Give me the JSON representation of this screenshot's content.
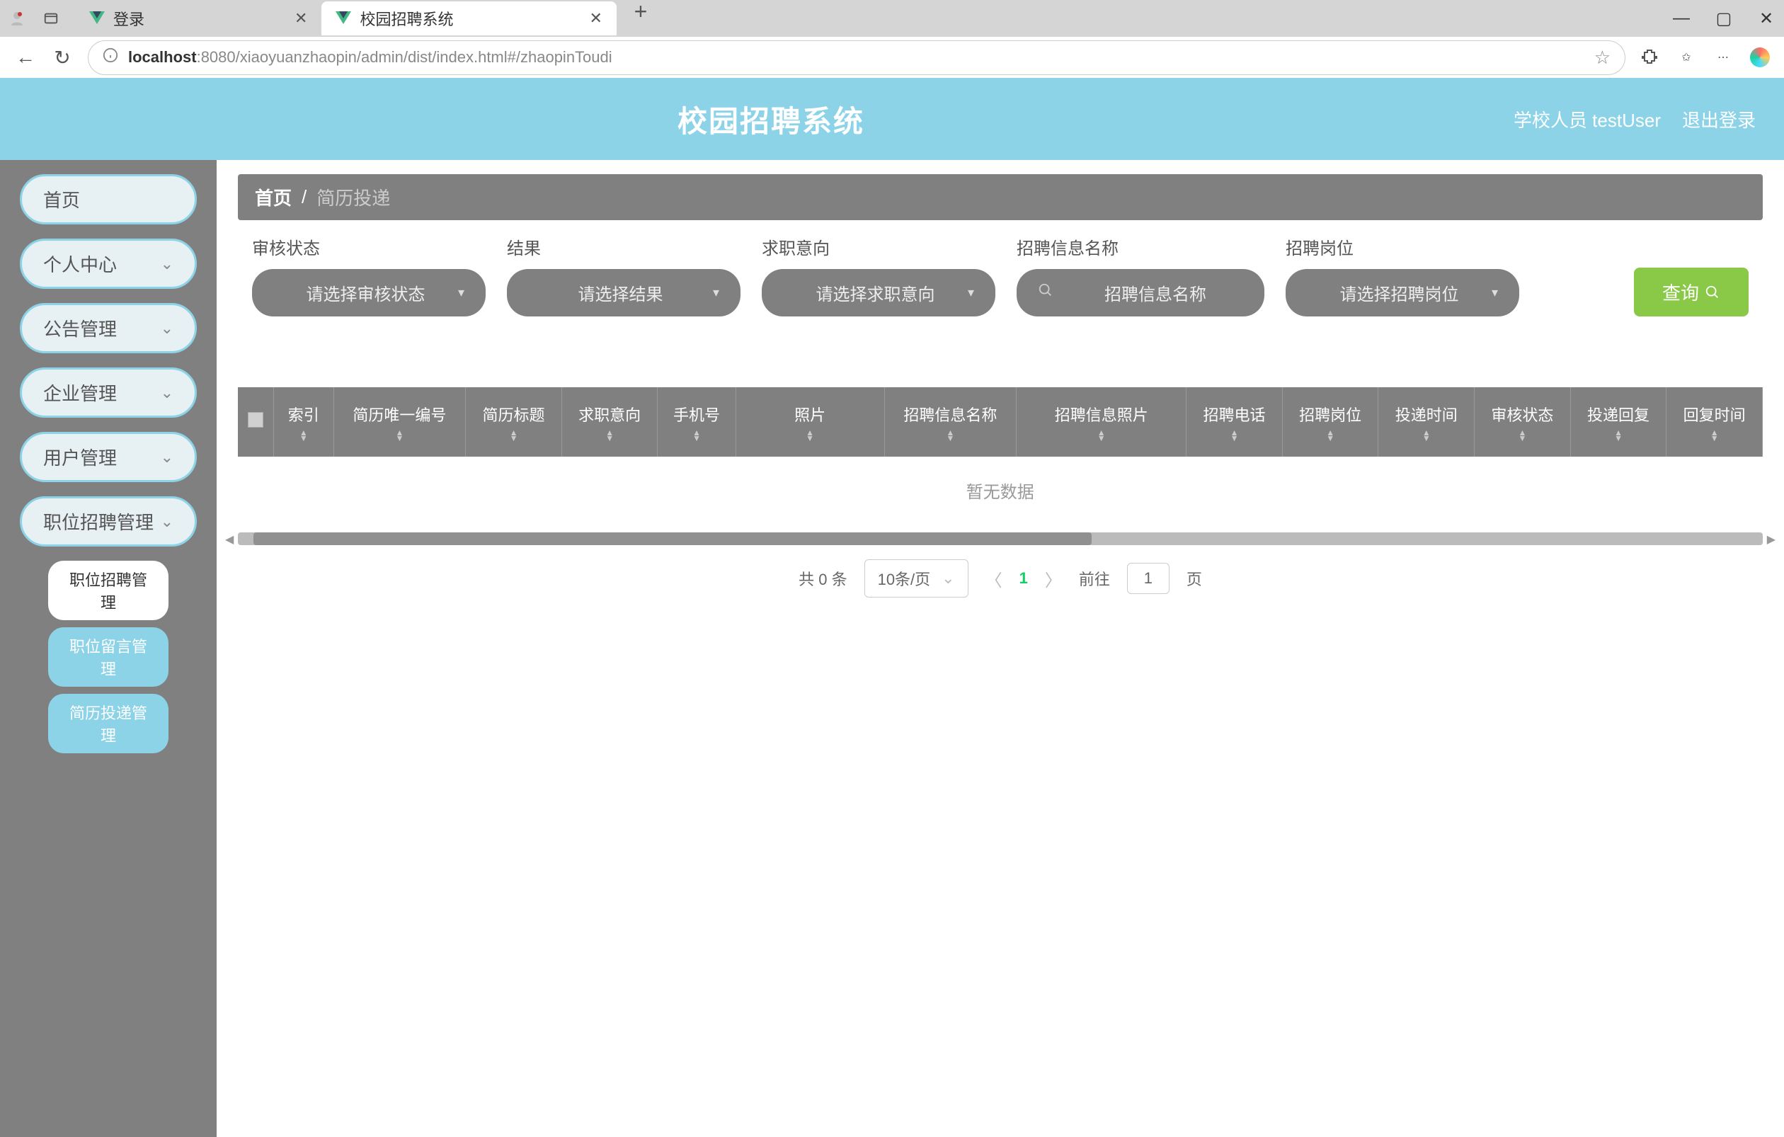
{
  "browser": {
    "tabs": [
      {
        "title": "登录"
      },
      {
        "title": "校园招聘系统"
      }
    ],
    "url_host": "localhost",
    "url_port": ":8080",
    "url_path": "/xiaoyuanzhaopin/admin/dist/index.html#/zhaopinToudi"
  },
  "header": {
    "title": "校园招聘系统",
    "user": "学校人员 testUser",
    "logout": "退出登录"
  },
  "sidebar": {
    "items": [
      {
        "label": "首页",
        "expandable": false
      },
      {
        "label": "个人中心",
        "expandable": true
      },
      {
        "label": "公告管理",
        "expandable": true
      },
      {
        "label": "企业管理",
        "expandable": true
      },
      {
        "label": "用户管理",
        "expandable": true
      },
      {
        "label": "职位招聘管理",
        "expandable": true
      }
    ],
    "subItems": [
      {
        "label": "职位招聘管理",
        "active": false
      },
      {
        "label": "职位留言管理",
        "active": true
      },
      {
        "label": "简历投递管理",
        "active": true
      }
    ]
  },
  "breadcrumb": {
    "home": "首页",
    "sep": "/",
    "current": "简历投递"
  },
  "filters": {
    "f1": {
      "label": "审核状态",
      "placeholder": "请选择审核状态"
    },
    "f2": {
      "label": "结果",
      "placeholder": "请选择结果"
    },
    "f3": {
      "label": "求职意向",
      "placeholder": "请选择求职意向"
    },
    "f4": {
      "label": "招聘信息名称",
      "placeholder": "招聘信息名称"
    },
    "f5": {
      "label": "招聘岗位",
      "placeholder": "请选择招聘岗位"
    },
    "queryBtn": "查询"
  },
  "table": {
    "columns": [
      "索引",
      "简历唯一编号",
      "简历标题",
      "求职意向",
      "手机号",
      "照片",
      "招聘信息名称",
      "招聘信息照片",
      "招聘电话",
      "招聘岗位",
      "投递时间",
      "审核状态",
      "投递回复",
      "回复时间"
    ],
    "emptyText": "暂无数据"
  },
  "pagination": {
    "total": "共 0 条",
    "pageSize": "10条/页",
    "current": "1",
    "gotoLabel": "前往",
    "gotoValue": "1",
    "pageSuffix": "页"
  }
}
